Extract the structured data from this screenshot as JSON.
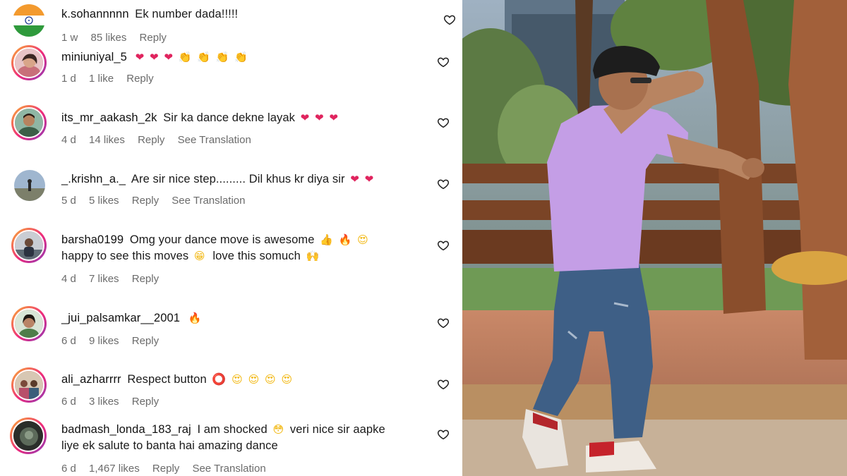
{
  "comments": [
    {
      "username": "k.sohannnnn",
      "text": "Ek number dada!!!!!",
      "emojis": [],
      "age": "1 w",
      "likes": "85 likes",
      "reply": "Reply",
      "avatar": "india-flag"
    },
    {
      "username": "miniuniyal_5",
      "text": "",
      "emojis": [
        "❤",
        "❤",
        "❤",
        "👏",
        "👏",
        "👏",
        "👏"
      ],
      "age": "1 d",
      "likes": "1 like",
      "reply": "Reply",
      "avatar": "girl-selfie"
    },
    {
      "username": "its_mr_aakash_2k",
      "text": "Sir ka dance dekne layak",
      "emojis": [
        "❤",
        "❤",
        "❤"
      ],
      "age": "4 d",
      "likes": "14 likes",
      "reply": "Reply",
      "translate": "See Translation",
      "avatar": "man-portrait"
    },
    {
      "username": "_.krishn_a._",
      "text": "Are sir nice step......... Dil khus kr diya sir",
      "emojis": [
        "❤",
        "❤"
      ],
      "age": "5 d",
      "likes": "5 likes",
      "reply": "Reply",
      "translate": "See Translation",
      "avatar": "landscape"
    },
    {
      "username": "barsha0199",
      "text": "Omg your dance move is awesome",
      "emojis": [
        "👍",
        "🔥",
        "😍"
      ],
      "text2": "happy to see this moves",
      "emojis2": [
        "😁"
      ],
      "text3": "love this somuch",
      "emojis3": [
        "🙌"
      ],
      "age": "4 d",
      "likes": "7 likes",
      "reply": "Reply",
      "avatar": "man-outdoor"
    },
    {
      "username": "_jui_palsamkar__2001",
      "text": "",
      "emojis": [
        "🔥"
      ],
      "age": "6 d",
      "likes": "9 likes",
      "reply": "Reply",
      "avatar": "girl-portrait"
    },
    {
      "username": "ali_azharrrr",
      "text": "Respect button",
      "emojis": [
        "⭕",
        "😍",
        "😍",
        "😍",
        "😍"
      ],
      "age": "6 d",
      "likes": "3 likes",
      "reply": "Reply",
      "avatar": "group-photo"
    },
    {
      "username": "badmash_londa_183_raj",
      "text": "I am shocked",
      "emojis": [
        "😳"
      ],
      "text2": "veri nice sir aapke",
      "text3": "liye ek salute to banta hai amazing dance",
      "age": "6 d",
      "likes": "1,467 likes",
      "reply": "Reply",
      "translate": "See Translation",
      "avatar": "dark-portrait"
    }
  ],
  "colors": {
    "heart": "#e0245e",
    "story_ring_start": "#f9b233",
    "story_ring_mid": "#ee2a7b",
    "story_ring_end": "#8a3ab9",
    "meta_text": "#6b6b6b"
  },
  "icons": {
    "like": "heart-outline-icon"
  }
}
